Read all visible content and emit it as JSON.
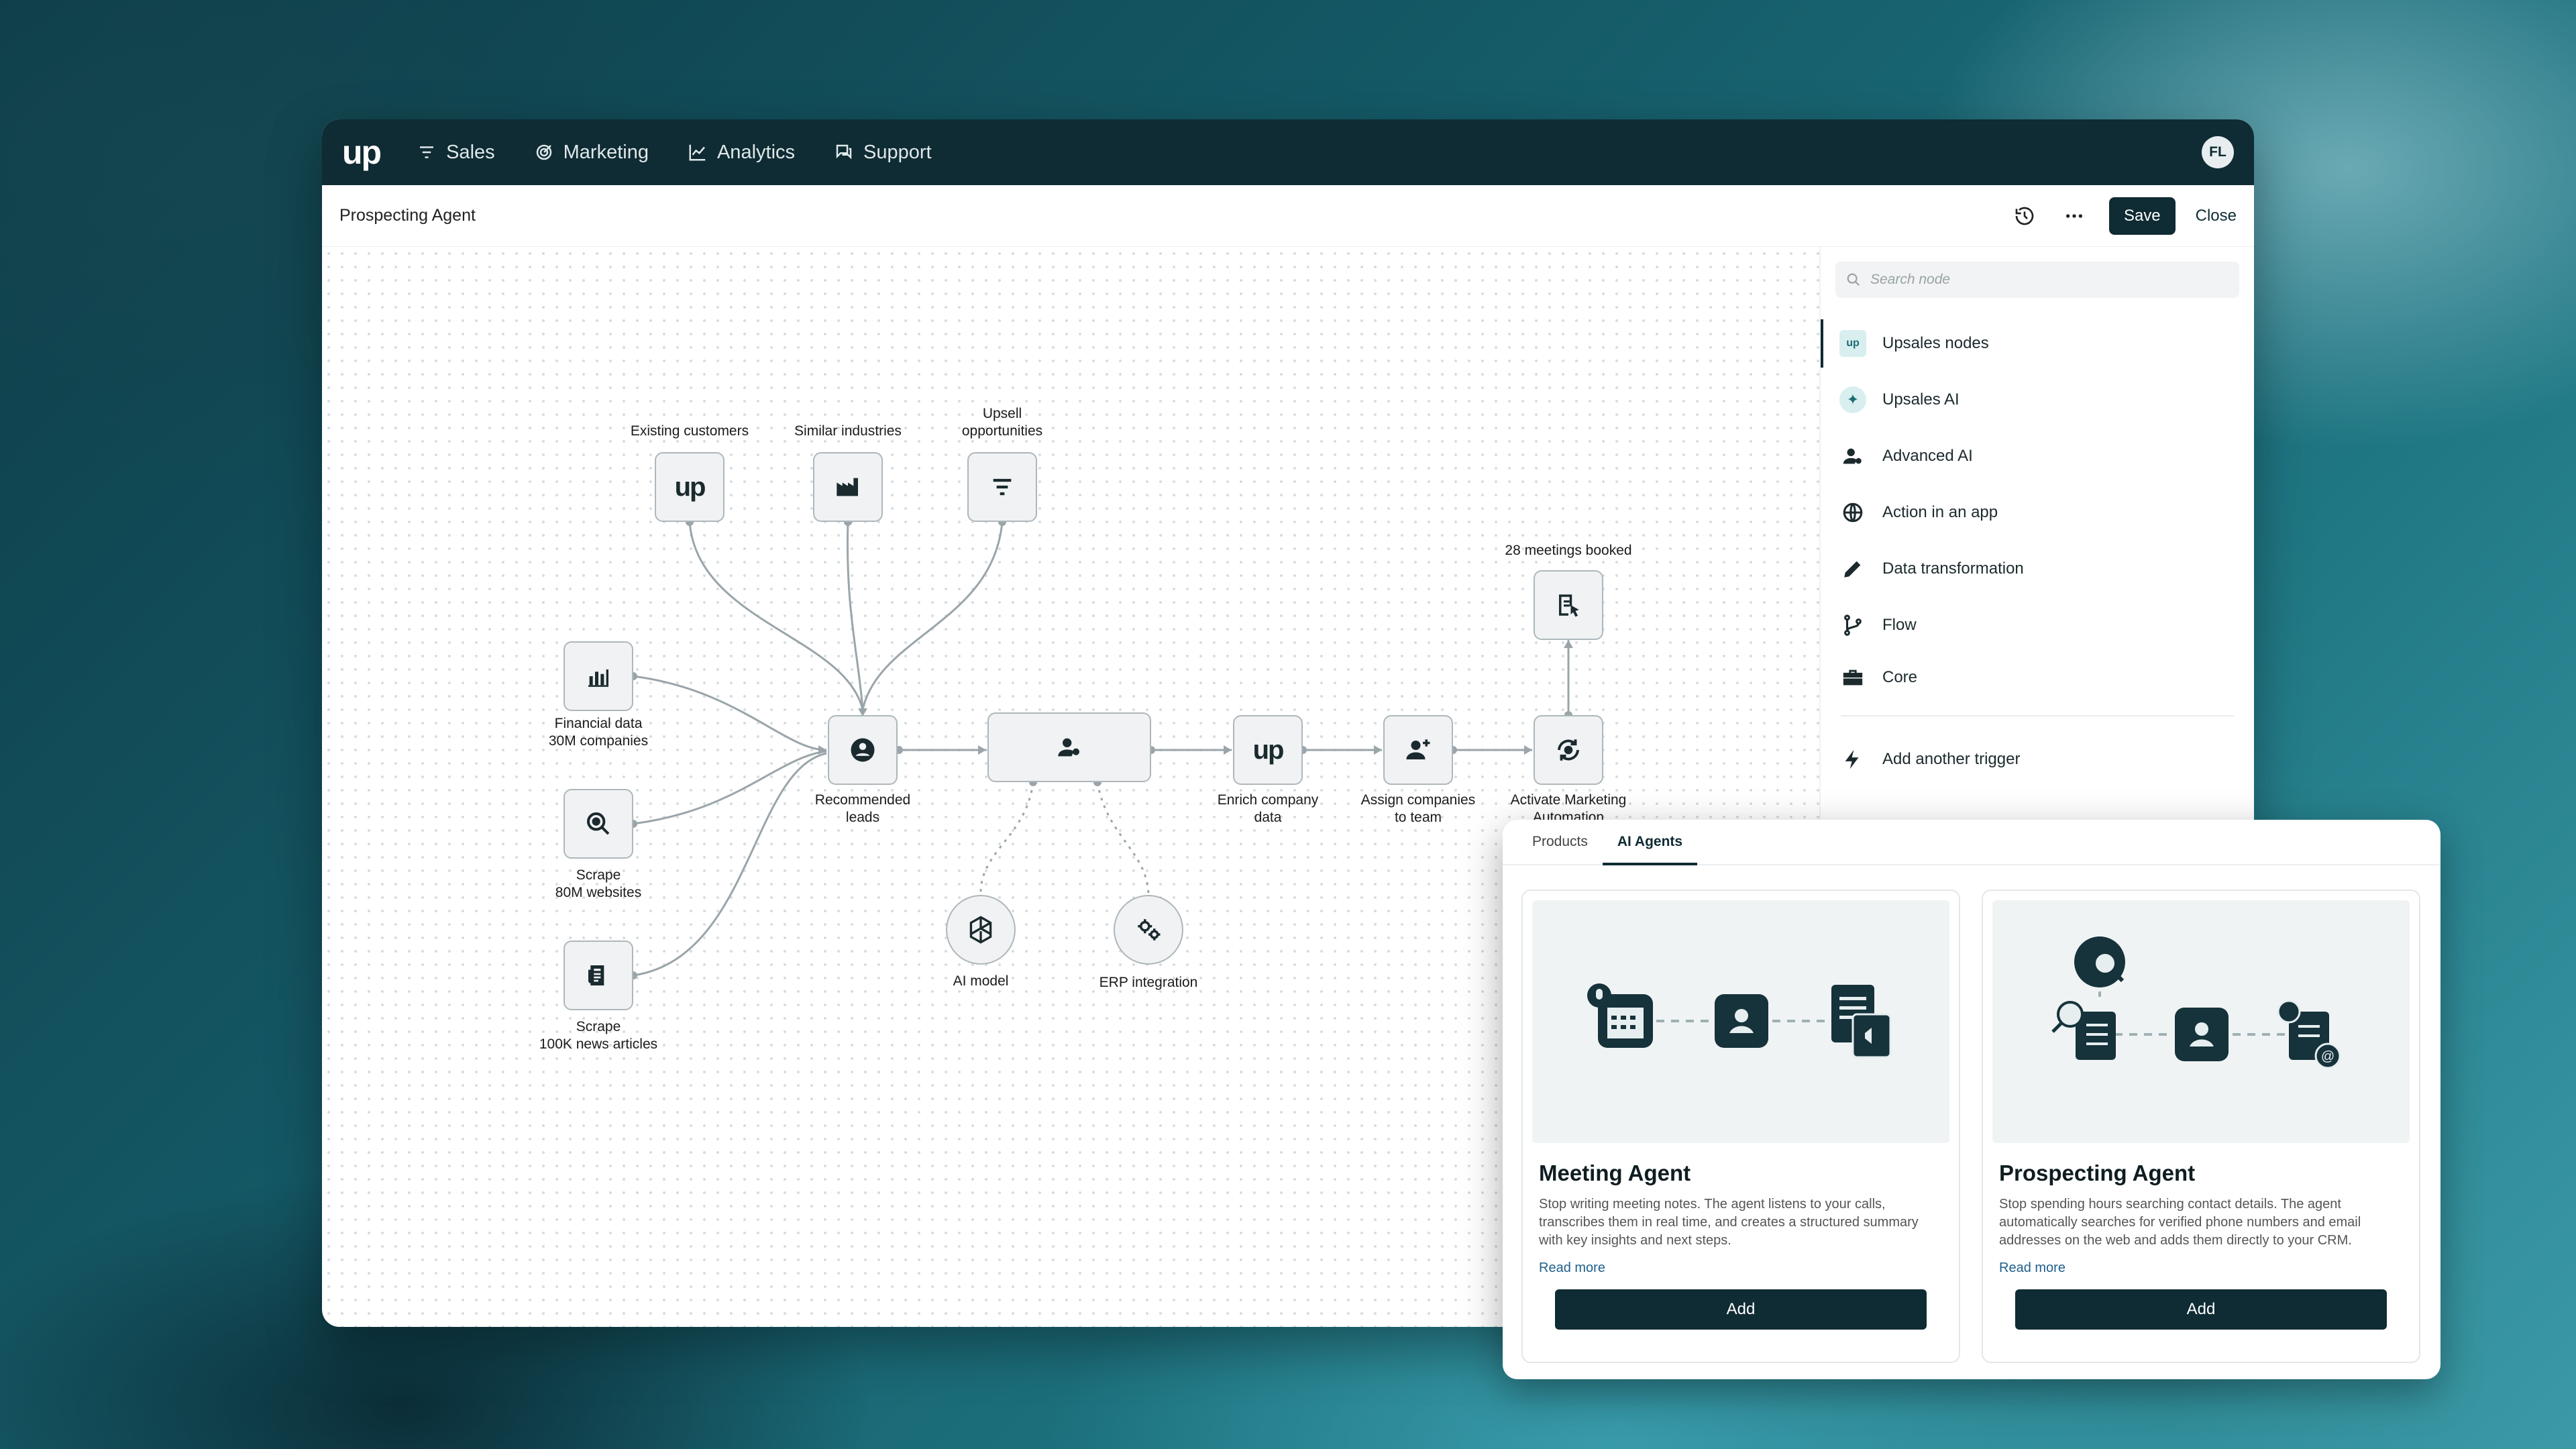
{
  "app": {
    "logo": "up",
    "nav": [
      "Sales",
      "Marketing",
      "Analytics",
      "Support"
    ],
    "avatar_initials": "FL"
  },
  "header": {
    "title": "Prospecting Agent",
    "save_label": "Save",
    "close_label": "Close"
  },
  "sidebar": {
    "search_placeholder": "Search node",
    "items": [
      {
        "label": "Upsales nodes",
        "icon": "upsales-logo-icon"
      },
      {
        "label": "Upsales AI",
        "icon": "sparkle-icon"
      },
      {
        "label": "Advanced AI",
        "icon": "user-gear-icon"
      },
      {
        "label": "Action in an app",
        "icon": "globe-icon"
      },
      {
        "label": "Data transformation",
        "icon": "pencil-icon"
      },
      {
        "label": "Flow",
        "icon": "branch-icon"
      },
      {
        "label": "Core",
        "icon": "toolbox-icon"
      }
    ],
    "trigger_label": "Add another trigger"
  },
  "flow": {
    "nodes": {
      "existing_customers": "Existing customers",
      "similar_industries": "Similar industries",
      "upsell_opportunities_1": "Upsell",
      "upsell_opportunities_2": "opportunities",
      "financial_1": "Financial data",
      "financial_2": "30M companies",
      "scrape_web_1": "Scrape",
      "scrape_web_2": "80M websites",
      "scrape_news_1": "Scrape",
      "scrape_news_2": "100K news articles",
      "recommended_1": "Recommended",
      "recommended_2": "leads",
      "ai_model": "AI model",
      "erp": "ERP integration",
      "enrich_1": "Enrich company",
      "enrich_2": "data",
      "assign_1": "Assign companies",
      "assign_2": "to team",
      "activate_1": "Activate Marketing",
      "activate_2": "Automation",
      "meetings": "28 meetings booked",
      "up_text": "up"
    }
  },
  "panel": {
    "tabs": [
      "Products",
      "AI Agents"
    ],
    "cards": [
      {
        "title": "Meeting Agent",
        "description": "Stop writing meeting notes. The agent listens to your calls, transcribes them in real time, and creates a structured summary with key insights and next steps.",
        "link": "Read more",
        "button": "Add"
      },
      {
        "title": "Prospecting Agent",
        "description": "Stop spending hours searching contact details. The agent automatically searches for verified phone numbers and email addresses on the web and adds them directly to your CRM.",
        "link": "Read more",
        "button": "Add"
      }
    ]
  },
  "colors": {
    "brand_dark": "#0f2b33",
    "accent_teal": "#1b6c74",
    "node_border": "#aeb7bb"
  }
}
